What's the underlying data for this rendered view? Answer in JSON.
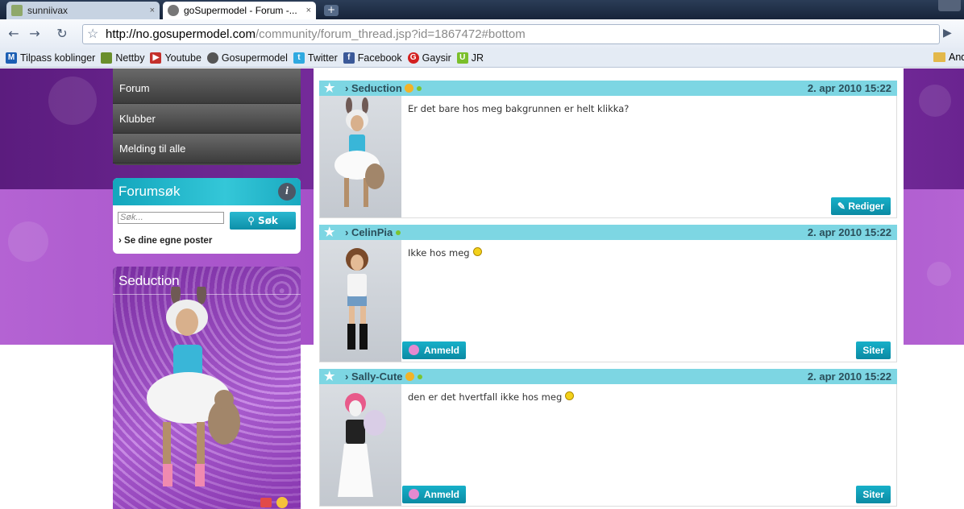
{
  "browser": {
    "tabs": [
      {
        "title": "sunniivax",
        "close": "×"
      },
      {
        "title": "goSupermodel - Forum -...",
        "close": "×"
      }
    ],
    "new_tab": "+",
    "url_host": "http://no.gosupermodel.com",
    "url_path": "/community/forum_thread.jsp?id=1867472#bottom",
    "bookmarks": [
      {
        "label": "Tilpass koblinger",
        "icon": "m-icon",
        "color": "#1c5fb4"
      },
      {
        "label": "Nettby",
        "icon": "nettby-icon",
        "color": "#6a8f2c"
      },
      {
        "label": "Youtube",
        "icon": "youtube-icon",
        "color": "#c4302b"
      },
      {
        "label": "Gosupermodel",
        "icon": "gosupermodel-icon",
        "color": "#555555"
      },
      {
        "label": "Twitter",
        "icon": "twitter-icon",
        "color": "#2fa9e0"
      },
      {
        "label": "Facebook",
        "icon": "facebook-icon",
        "color": "#3b5998"
      },
      {
        "label": "Gaysir",
        "icon": "gaysir-icon",
        "color": "#d32020"
      },
      {
        "label": "JR",
        "icon": "jr-icon",
        "color": "#7bbf2b"
      }
    ],
    "other_bookmarks": "And"
  },
  "sidebar": {
    "nav": [
      "Forum",
      "Klubber",
      "Melding til alle"
    ],
    "search": {
      "title": "Forumsøk",
      "placeholder": "Søk...",
      "button": "Søk",
      "own_posts": "› Se dine egne poster"
    },
    "avatar_name": "Seduction"
  },
  "posts": [
    {
      "author": "› Seduction",
      "date": "2. apr 2010 15:22",
      "text": "Er det bare hos meg bakgrunnen er helt klikka?",
      "smiley": false,
      "vip": true,
      "avatar_color": "#3fb0d8",
      "buttons": {
        "left": null,
        "right": "Rediger"
      }
    },
    {
      "author": "› CelinPia",
      "date": "2. apr 2010 15:22",
      "text": "Ikke hos meg",
      "smiley": true,
      "vip": false,
      "avatar_color": "#7a4a2a",
      "buttons": {
        "left": "Anmeld",
        "right": "Siter"
      }
    },
    {
      "author": "› Sally-Cute",
      "date": "2. apr 2010 15:22",
      "text": "den er det hvertfall ikke hos meg",
      "smiley": true,
      "vip": true,
      "avatar_color": "#222222",
      "buttons": {
        "left": "Anmeld",
        "right": "Siter"
      }
    }
  ]
}
